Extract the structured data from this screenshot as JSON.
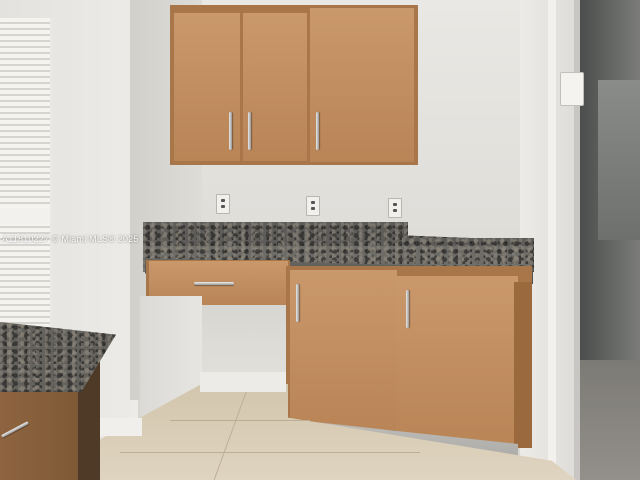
{
  "photo": {
    "watermark": "A11810227 © Miami MLS® 2025"
  },
  "colors": {
    "cabinet_wood": "#c38f61",
    "granite": "#5d5c58",
    "wall": "#e6e4e0",
    "floor_tile": "#d8ccb6"
  }
}
